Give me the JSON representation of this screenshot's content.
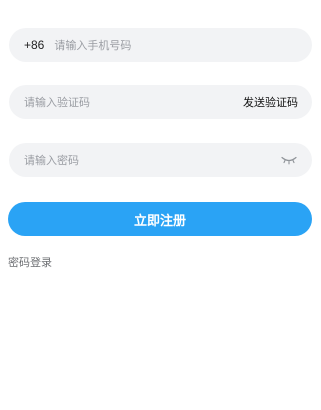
{
  "form": {
    "phone": {
      "prefix": "+86",
      "placeholder": "请输入手机号码",
      "value": ""
    },
    "code": {
      "placeholder": "请输入验证码",
      "value": "",
      "send_label": "发送验证码"
    },
    "password": {
      "placeholder": "请输入密码",
      "value": "",
      "toggle_icon": "eye-closed-icon"
    }
  },
  "actions": {
    "register_label": "立即注册",
    "password_login_label": "密码登录"
  },
  "colors": {
    "primary": "#2aa3f5",
    "field_bg": "#f2f3f5",
    "placeholder": "#9a9da3",
    "secondary_text": "#6d6f73"
  }
}
